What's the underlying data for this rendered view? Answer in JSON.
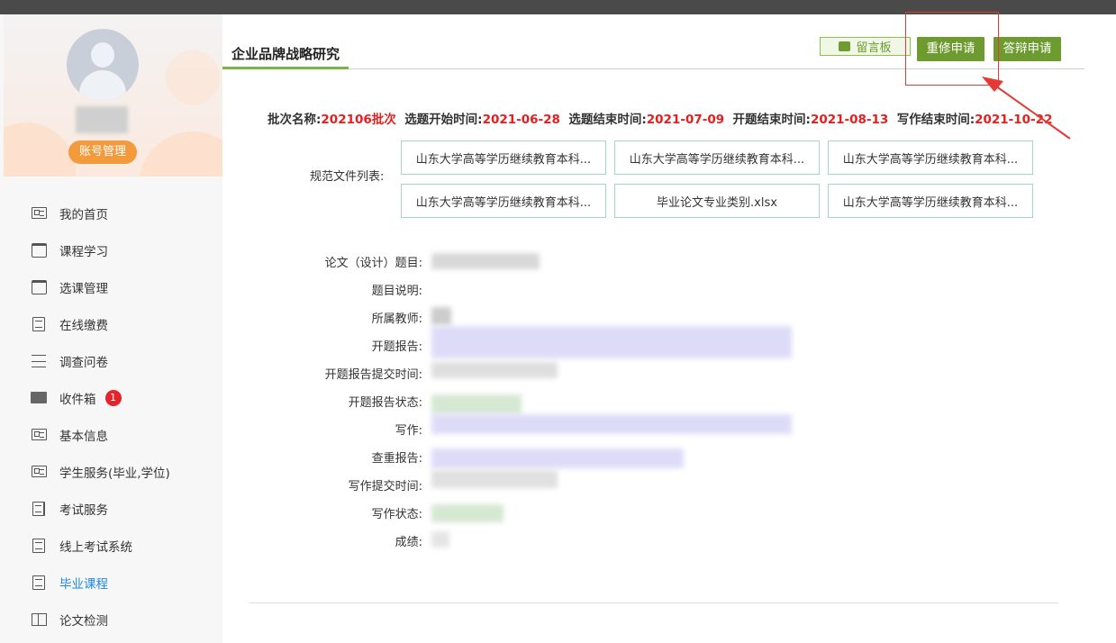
{
  "sidebar": {
    "account_button": "账号管理",
    "items": [
      {
        "label": "我的首页",
        "icon": "id-card-icon"
      },
      {
        "label": "课程学习",
        "icon": "calendar-icon"
      },
      {
        "label": "选课管理",
        "icon": "calendar-icon"
      },
      {
        "label": "在线缴费",
        "icon": "document-icon"
      },
      {
        "label": "调查问卷",
        "icon": "list-icon"
      },
      {
        "label": "收件箱",
        "icon": "mail-icon",
        "badge": "1"
      },
      {
        "label": "基本信息",
        "icon": "id-card-icon"
      },
      {
        "label": "学生服务(毕业,学位)",
        "icon": "id-card-icon"
      },
      {
        "label": "考试服务",
        "icon": "edit-document-icon"
      },
      {
        "label": "线上考试系统",
        "icon": "document-icon"
      },
      {
        "label": "毕业课程",
        "icon": "document-icon",
        "active": true
      },
      {
        "label": "论文检测",
        "icon": "book-icon"
      }
    ]
  },
  "main": {
    "title": "企业品牌战略研究",
    "buttons": {
      "message_board": "留言板",
      "redo_apply": "重修申请",
      "defense_apply": "答辩申请"
    },
    "batch": {
      "name_label": "批次名称:",
      "name_value": "202106批次",
      "select_start_label": "选题开始时间:",
      "select_start_value": "2021-06-28",
      "select_end_label": "选题结束时间:",
      "select_end_value": "2021-07-09",
      "proposal_end_label": "开题结束时间:",
      "proposal_end_value": "2021-08-13",
      "writing_end_label": "写作结束时间:",
      "writing_end_value": "2021-10-22"
    },
    "files_label": "规范文件列表:",
    "files": [
      "山东大学高等学历继续教育本科...",
      "山东大学高等学历继续教育本科...",
      "山东大学高等学历继续教育本科...",
      "山东大学高等学历继续教育本科...",
      "毕业论文专业类别.xlsx",
      "山东大学高等学历继续教育本科..."
    ],
    "fields": {
      "thesis_title": "论文（设计）题目:",
      "title_desc": "题目说明:",
      "teacher": "所属教师:",
      "proposal_report": "开题报告:",
      "proposal_submit_time": "开题报告提交时间:",
      "proposal_status": "开题报告状态:",
      "writing": "写作:",
      "plagiarism_report": "查重报告:",
      "writing_submit_time": "写作提交时间:",
      "writing_status": "写作状态:",
      "score": "成绩:"
    }
  },
  "colors": {
    "accent_green": "#6d9b2f",
    "date_red": "#e61e1e",
    "active_blue": "#1e88e5",
    "account_orange": "#f39a3d",
    "annotation_red": "#e53935"
  }
}
